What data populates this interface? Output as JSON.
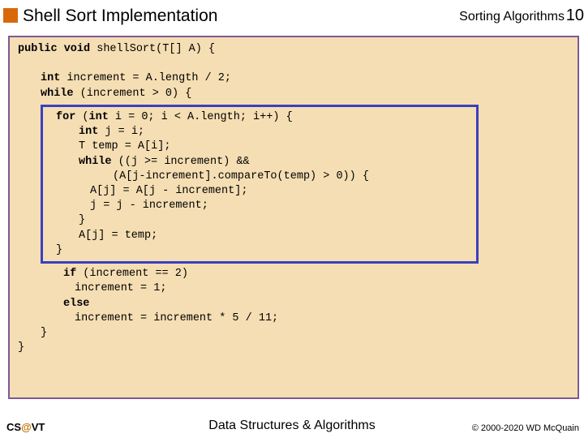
{
  "header": {
    "title": "Shell Sort Implementation",
    "category": "Sorting Algorithms",
    "page_number": "10"
  },
  "code": {
    "l1a": "public void",
    "l1b": " shellSort(T[] A) {",
    "l2a": "int",
    "l2b": " increment = A.length / 2;",
    "l3a": "while",
    "l3b": " (increment > 0) {",
    "inner": {
      "l1a": "for",
      "l1b": " (",
      "l1c": "int",
      "l1d": " i = 0; i < A.length; i++) {",
      "l2a": "int",
      "l2b": " j = i;",
      "l3": "T temp = A[i];",
      "l4a": "while",
      "l4b": " ((j >= increment) &&",
      "l5": "(A[j-increment].compareTo(temp) > 0)) {",
      "l6": "A[j] = A[j - increment];",
      "l7": "j = j - increment;",
      "l8": "}",
      "l9": "A[j] = temp;",
      "l10": "}"
    },
    "t1a": "if",
    "t1b": " (increment == 2)",
    "t2": "increment = 1;",
    "t3a": "else",
    "t4": "increment = increment * 5 / 11;",
    "t5": "}",
    "t6": "}"
  },
  "footer": {
    "left_cs": "CS",
    "left_at": "@",
    "left_vt": "VT",
    "center": "Data Structures & Algorithms",
    "right": "© 2000-2020 WD McQuain"
  }
}
